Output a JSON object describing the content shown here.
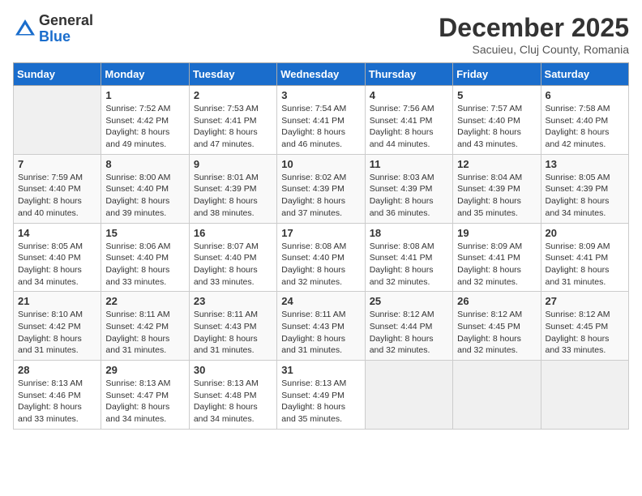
{
  "logo": {
    "general": "General",
    "blue": "Blue"
  },
  "title": "December 2025",
  "location": "Sacuieu, Cluj County, Romania",
  "days_header": [
    "Sunday",
    "Monday",
    "Tuesday",
    "Wednesday",
    "Thursday",
    "Friday",
    "Saturday"
  ],
  "weeks": [
    [
      {
        "day": "",
        "sunrise": "",
        "sunset": "",
        "daylight": ""
      },
      {
        "day": "1",
        "sunrise": "Sunrise: 7:52 AM",
        "sunset": "Sunset: 4:42 PM",
        "daylight": "Daylight: 8 hours and 49 minutes."
      },
      {
        "day": "2",
        "sunrise": "Sunrise: 7:53 AM",
        "sunset": "Sunset: 4:41 PM",
        "daylight": "Daylight: 8 hours and 47 minutes."
      },
      {
        "day": "3",
        "sunrise": "Sunrise: 7:54 AM",
        "sunset": "Sunset: 4:41 PM",
        "daylight": "Daylight: 8 hours and 46 minutes."
      },
      {
        "day": "4",
        "sunrise": "Sunrise: 7:56 AM",
        "sunset": "Sunset: 4:41 PM",
        "daylight": "Daylight: 8 hours and 44 minutes."
      },
      {
        "day": "5",
        "sunrise": "Sunrise: 7:57 AM",
        "sunset": "Sunset: 4:40 PM",
        "daylight": "Daylight: 8 hours and 43 minutes."
      },
      {
        "day": "6",
        "sunrise": "Sunrise: 7:58 AM",
        "sunset": "Sunset: 4:40 PM",
        "daylight": "Daylight: 8 hours and 42 minutes."
      }
    ],
    [
      {
        "day": "7",
        "sunrise": "Sunrise: 7:59 AM",
        "sunset": "Sunset: 4:40 PM",
        "daylight": "Daylight: 8 hours and 40 minutes."
      },
      {
        "day": "8",
        "sunrise": "Sunrise: 8:00 AM",
        "sunset": "Sunset: 4:40 PM",
        "daylight": "Daylight: 8 hours and 39 minutes."
      },
      {
        "day": "9",
        "sunrise": "Sunrise: 8:01 AM",
        "sunset": "Sunset: 4:39 PM",
        "daylight": "Daylight: 8 hours and 38 minutes."
      },
      {
        "day": "10",
        "sunrise": "Sunrise: 8:02 AM",
        "sunset": "Sunset: 4:39 PM",
        "daylight": "Daylight: 8 hours and 37 minutes."
      },
      {
        "day": "11",
        "sunrise": "Sunrise: 8:03 AM",
        "sunset": "Sunset: 4:39 PM",
        "daylight": "Daylight: 8 hours and 36 minutes."
      },
      {
        "day": "12",
        "sunrise": "Sunrise: 8:04 AM",
        "sunset": "Sunset: 4:39 PM",
        "daylight": "Daylight: 8 hours and 35 minutes."
      },
      {
        "day": "13",
        "sunrise": "Sunrise: 8:05 AM",
        "sunset": "Sunset: 4:39 PM",
        "daylight": "Daylight: 8 hours and 34 minutes."
      }
    ],
    [
      {
        "day": "14",
        "sunrise": "Sunrise: 8:05 AM",
        "sunset": "Sunset: 4:40 PM",
        "daylight": "Daylight: 8 hours and 34 minutes."
      },
      {
        "day": "15",
        "sunrise": "Sunrise: 8:06 AM",
        "sunset": "Sunset: 4:40 PM",
        "daylight": "Daylight: 8 hours and 33 minutes."
      },
      {
        "day": "16",
        "sunrise": "Sunrise: 8:07 AM",
        "sunset": "Sunset: 4:40 PM",
        "daylight": "Daylight: 8 hours and 33 minutes."
      },
      {
        "day": "17",
        "sunrise": "Sunrise: 8:08 AM",
        "sunset": "Sunset: 4:40 PM",
        "daylight": "Daylight: 8 hours and 32 minutes."
      },
      {
        "day": "18",
        "sunrise": "Sunrise: 8:08 AM",
        "sunset": "Sunset: 4:41 PM",
        "daylight": "Daylight: 8 hours and 32 minutes."
      },
      {
        "day": "19",
        "sunrise": "Sunrise: 8:09 AM",
        "sunset": "Sunset: 4:41 PM",
        "daylight": "Daylight: 8 hours and 32 minutes."
      },
      {
        "day": "20",
        "sunrise": "Sunrise: 8:09 AM",
        "sunset": "Sunset: 4:41 PM",
        "daylight": "Daylight: 8 hours and 31 minutes."
      }
    ],
    [
      {
        "day": "21",
        "sunrise": "Sunrise: 8:10 AM",
        "sunset": "Sunset: 4:42 PM",
        "daylight": "Daylight: 8 hours and 31 minutes."
      },
      {
        "day": "22",
        "sunrise": "Sunrise: 8:11 AM",
        "sunset": "Sunset: 4:42 PM",
        "daylight": "Daylight: 8 hours and 31 minutes."
      },
      {
        "day": "23",
        "sunrise": "Sunrise: 8:11 AM",
        "sunset": "Sunset: 4:43 PM",
        "daylight": "Daylight: 8 hours and 31 minutes."
      },
      {
        "day": "24",
        "sunrise": "Sunrise: 8:11 AM",
        "sunset": "Sunset: 4:43 PM",
        "daylight": "Daylight: 8 hours and 31 minutes."
      },
      {
        "day": "25",
        "sunrise": "Sunrise: 8:12 AM",
        "sunset": "Sunset: 4:44 PM",
        "daylight": "Daylight: 8 hours and 32 minutes."
      },
      {
        "day": "26",
        "sunrise": "Sunrise: 8:12 AM",
        "sunset": "Sunset: 4:45 PM",
        "daylight": "Daylight: 8 hours and 32 minutes."
      },
      {
        "day": "27",
        "sunrise": "Sunrise: 8:12 AM",
        "sunset": "Sunset: 4:45 PM",
        "daylight": "Daylight: 8 hours and 33 minutes."
      }
    ],
    [
      {
        "day": "28",
        "sunrise": "Sunrise: 8:13 AM",
        "sunset": "Sunset: 4:46 PM",
        "daylight": "Daylight: 8 hours and 33 minutes."
      },
      {
        "day": "29",
        "sunrise": "Sunrise: 8:13 AM",
        "sunset": "Sunset: 4:47 PM",
        "daylight": "Daylight: 8 hours and 34 minutes."
      },
      {
        "day": "30",
        "sunrise": "Sunrise: 8:13 AM",
        "sunset": "Sunset: 4:48 PM",
        "daylight": "Daylight: 8 hours and 34 minutes."
      },
      {
        "day": "31",
        "sunrise": "Sunrise: 8:13 AM",
        "sunset": "Sunset: 4:49 PM",
        "daylight": "Daylight: 8 hours and 35 minutes."
      },
      {
        "day": "",
        "sunrise": "",
        "sunset": "",
        "daylight": ""
      },
      {
        "day": "",
        "sunrise": "",
        "sunset": "",
        "daylight": ""
      },
      {
        "day": "",
        "sunrise": "",
        "sunset": "",
        "daylight": ""
      }
    ]
  ]
}
